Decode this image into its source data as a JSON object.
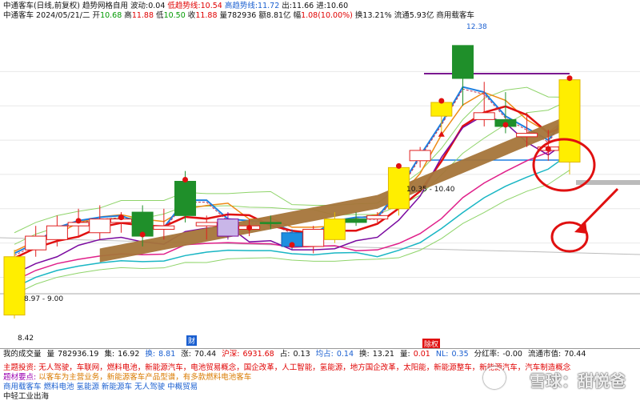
{
  "header": {
    "line1": {
      "title": "中通客车(日线,前复权)",
      "indicator": "趋势网格自用",
      "wave_label": "波动:",
      "wave_value": "0.04",
      "low_trend_label": "低趋势线:",
      "low_trend_value": "10.54",
      "high_trend_label": "高趋势线:",
      "high_trend_value": "11.72",
      "top_label": "出:",
      "top_value": "11.66",
      "bottom_label": "进:",
      "bottom_value": "10.60"
    },
    "line2": {
      "name": "中通客车",
      "date": "2024/05/21/二",
      "open_label": "开",
      "open": "10.68",
      "high_label": "高",
      "high": "11.88",
      "low_label": "低",
      "low": "10.50",
      "close_label": "收",
      "close": "11.88",
      "vol_label": "量",
      "vol": "782936",
      "amount_label": "额",
      "amount": "8.81亿",
      "change_label": "幅",
      "change": "1.08(10.00%)",
      "turnover_label": "换",
      "turnover": "13.21%",
      "float_label": "流通",
      "float": "5.93亿",
      "sector": "商用载客车"
    }
  },
  "bottom_bar": {
    "title": "我的成交量",
    "vol_label": "量",
    "vol": "782936.19",
    "ji_label": "集:",
    "ji": "16.92",
    "huan_label": "换:",
    "huan": "8.81",
    "zhang_label": "涨:",
    "zhang": "70.44",
    "hu_label": "沪深:",
    "hu": "6931.68",
    "zhan_label": "占:",
    "zhan": "0.13",
    "junzhi_label": "均占:",
    "junzhi": "0.14",
    "huan2_label": "换:",
    "huan2": "13.21",
    "lb_label": "量:",
    "lb": "0.01",
    "nl_label": "NL:",
    "nl": "0.35",
    "fh_label": "分红率:",
    "fh": "-0.00",
    "ltsz_label": "流通市值:",
    "ltsz": "70.44"
  },
  "concepts": {
    "row1_label": "主题投资:",
    "row1_text": "无人驾驶，车联网，燃料电池，新能源汽车，电池贸易概念，国企改革，人工智能，氢能源，地方国企改革，太阳能，新能源整车，新能源汽车，汽车制造概念",
    "row2_label": "题材要点:",
    "row2_text": "以客车为主营业务，新能源客车产品型谱，有多款燃料电池客车",
    "row3_text": "商用载客车 燃料电池 氢能源 新能源车 无人驾驶 中概贸易",
    "row4_text": "中轻工业出海"
  },
  "price_labels": {
    "top_high": "12.38",
    "low_left": "8.97 - 9.00",
    "low_min": "8.42",
    "grid_label": "10.35 - 10.40"
  },
  "markers": {
    "cai": "财",
    "fu": "除权"
  },
  "watermark": "雪球：甜悦爸",
  "chart_data": {
    "type": "candlestick",
    "title": "中通客车(日线,前复权)",
    "ylim": [
      8.2,
      12.6
    ],
    "candles": [
      {
        "open": 8.45,
        "close": 9.3,
        "high": 9.4,
        "low": 8.4,
        "color": "yellow"
      },
      {
        "open": 9.4,
        "close": 9.6,
        "high": 9.75,
        "low": 9.3,
        "color": "red"
      },
      {
        "open": 9.55,
        "close": 9.75,
        "high": 9.9,
        "low": 9.45,
        "color": "red"
      },
      {
        "open": 9.75,
        "close": 9.8,
        "high": 10.0,
        "low": 9.6,
        "color": "red"
      },
      {
        "open": 9.65,
        "close": 9.85,
        "high": 10.05,
        "low": 9.55,
        "color": "red"
      },
      {
        "open": 9.8,
        "close": 9.85,
        "high": 9.95,
        "low": 9.65,
        "color": "red"
      },
      {
        "open": 9.95,
        "close": 9.6,
        "high": 10.05,
        "low": 9.45,
        "color": "green"
      },
      {
        "open": 9.7,
        "close": 9.75,
        "high": 10.0,
        "low": 9.55,
        "color": "red"
      },
      {
        "open": 9.9,
        "close": 10.4,
        "high": 10.55,
        "low": 9.8,
        "color": "green"
      },
      {
        "open": 9.8,
        "close": 9.75,
        "high": 9.9,
        "low": 9.55,
        "color": "red"
      },
      {
        "open": 9.6,
        "close": 9.85,
        "high": 9.95,
        "low": 9.55,
        "color": "purple"
      },
      {
        "open": 9.75,
        "close": 9.7,
        "high": 9.85,
        "low": 9.6,
        "color": "red"
      },
      {
        "open": 9.8,
        "close": 9.8,
        "high": 9.9,
        "low": 9.7,
        "color": "green"
      },
      {
        "open": 9.65,
        "close": 9.45,
        "high": 9.7,
        "low": 9.4,
        "color": "blue"
      },
      {
        "open": 9.45,
        "close": 9.7,
        "high": 9.75,
        "low": 9.35,
        "color": "red"
      },
      {
        "open": 9.55,
        "close": 9.85,
        "high": 9.95,
        "low": 9.5,
        "color": "yellow"
      },
      {
        "open": 9.85,
        "close": 9.8,
        "high": 9.95,
        "low": 9.75,
        "color": "green"
      },
      {
        "open": 9.9,
        "close": 9.85,
        "high": 9.95,
        "low": 9.8,
        "color": "red"
      },
      {
        "open": 10.0,
        "close": 10.6,
        "high": 10.6,
        "low": 9.9,
        "color": "yellow"
      },
      {
        "open": 10.7,
        "close": 10.85,
        "high": 10.9,
        "low": 10.6,
        "color": "red"
      },
      {
        "open": 11.35,
        "close": 11.55,
        "high": 11.6,
        "low": 11.1,
        "color": "yellow"
      },
      {
        "open": 12.38,
        "close": 11.9,
        "high": 12.38,
        "low": 11.5,
        "color": "green"
      },
      {
        "open": 11.3,
        "close": 11.4,
        "high": 11.85,
        "low": 11.2,
        "color": "red"
      },
      {
        "open": 11.3,
        "close": 11.2,
        "high": 11.7,
        "low": 11.1,
        "color": "green"
      },
      {
        "open": 11.1,
        "close": 11.05,
        "high": 11.4,
        "low": 10.9,
        "color": "red"
      },
      {
        "open": 10.9,
        "close": 10.85,
        "high": 11.15,
        "low": 10.7,
        "color": "red"
      },
      {
        "open": 10.68,
        "close": 11.88,
        "high": 11.88,
        "low": 10.5,
        "color": "yellow"
      }
    ]
  },
  "colors": {
    "up": "#e02020",
    "down": "#1f8f2a",
    "yellow": "#ffee00",
    "band": "#a5753a",
    "ma_blue": "#1e7fe0",
    "ma_orange": "#ee8a16",
    "ma_green": "#8fd46a",
    "ma_pink": "#e0208a",
    "ma_cyan": "#19b6c4",
    "ma_purple": "#7a0aa0",
    "highlight": "#e01010"
  }
}
